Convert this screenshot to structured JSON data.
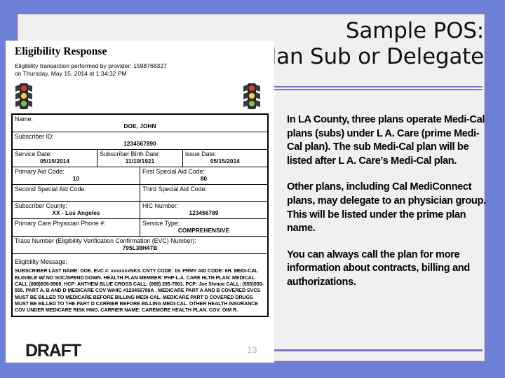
{
  "slide": {
    "title_lines": [
      "Sample POS:",
      "Plan Sub or Delegate"
    ],
    "page_number": "13",
    "watermark": "DRAFT",
    "colors": {
      "background": "#6b80d6",
      "frame_border": "#7b79c9",
      "frame_fill": "#f0f0f0",
      "divider": "#7b79c9"
    }
  },
  "body": {
    "paragraphs": [
      "In LA County, three plans operate Medi-Cal plans (subs) under L A. Care (prime Medi-Cal plan).  The sub Medi-Cal plan will be listed after L A. Care’s Medi-Cal plan.",
      "Other plans, including Cal MediConnect plans, may delegate to an physician group.  This will be listed under the prime plan name.",
      "You can always call the plan for more information about contracts, billing and authorizations."
    ]
  },
  "eligibility_form": {
    "heading": "Eligibility Response",
    "transaction_line1": "Eligibility transaction performed by provider: 1598768327",
    "transaction_line2": "on Thursday, May 15, 2014 at 1:34:32 PM",
    "traffic_lights": {
      "left": "traffic-light-icon",
      "right": "traffic-light-icon",
      "colors": [
        "#d43b2b",
        "#e8d34a",
        "#7fc24a"
      ]
    },
    "fields": {
      "name_label": "Name:",
      "name_value": "DOE, JOHN",
      "subscriber_id_label": "Subscriber ID:",
      "subscriber_id_value": "1234567890",
      "service_date_label": "Service Date:",
      "service_date_value": "05/15/2014",
      "birth_date_label": "Subscriber Birth Date:",
      "birth_date_value": "11/10/1921",
      "issue_date_label": "Issue Date:",
      "issue_date_value": "05/15/2014",
      "primary_aid_label": "Primary Aid Code:",
      "primary_aid_value": "10",
      "first_special_aid_label": "First Special Aid Code:",
      "first_special_aid_value": "80",
      "second_special_aid_label": "Second Special Aid Code:",
      "second_special_aid_value": "",
      "third_special_aid_label": "Third Special Aid Code:",
      "third_special_aid_value": "",
      "county_label": "Subscriber County:",
      "county_value": "XX - Los Angeles",
      "hic_label": "HIC Number:",
      "hic_value": "123456789",
      "pcp_phone_label": "Primary Care Physician Phone #:",
      "pcp_phone_value": "",
      "service_type_label": "Service Type:",
      "service_type_value": "COMPREHENSIVE",
      "trace_label": "Trace Number (Eligibility Verification Confirmation (EVC) Number):",
      "trace_value": "795L38H47B",
      "message_label": "Eligibility Message:",
      "message_value": "SUBSCRIBER LAST NAME: DOE. EVC #: xxxxxxxNK3. CNTY CODE: 19. PRMY AID CODE: 6H. MEDI-CAL ELIGIBLE W/ NO SOC/SPEND DOWN. HEALTH PLAN MEMBER: PHP-L.A. CARE HLTH PLAN:  MEDICAL CALL (888)839-9909. HCP: ANTHEM BLUE CROSS CALL:  (888) 285-7801.  PCP:  Joe Shmoe CALL: (555)555-555. PART A, B AND D MEDICARE COV W/HIC #123456789A  . MEDICARE PART A AND B COVERED SVCS MUST BE BILLED TO MEDICARE BEFORE BILLING MEDI-CAL. MEDICARE PART D COVERED DRUGS MUST BE BILLED TO THE PART D CARRIER BEFORE BILLING MEDI-CAL. OTHER HEALTH INSURANCE COV UNDER MEDICARE RISK HMO. CARRIER NAME: CAREMORE HEALTH PLAN. COV: OIM    R."
    }
  }
}
